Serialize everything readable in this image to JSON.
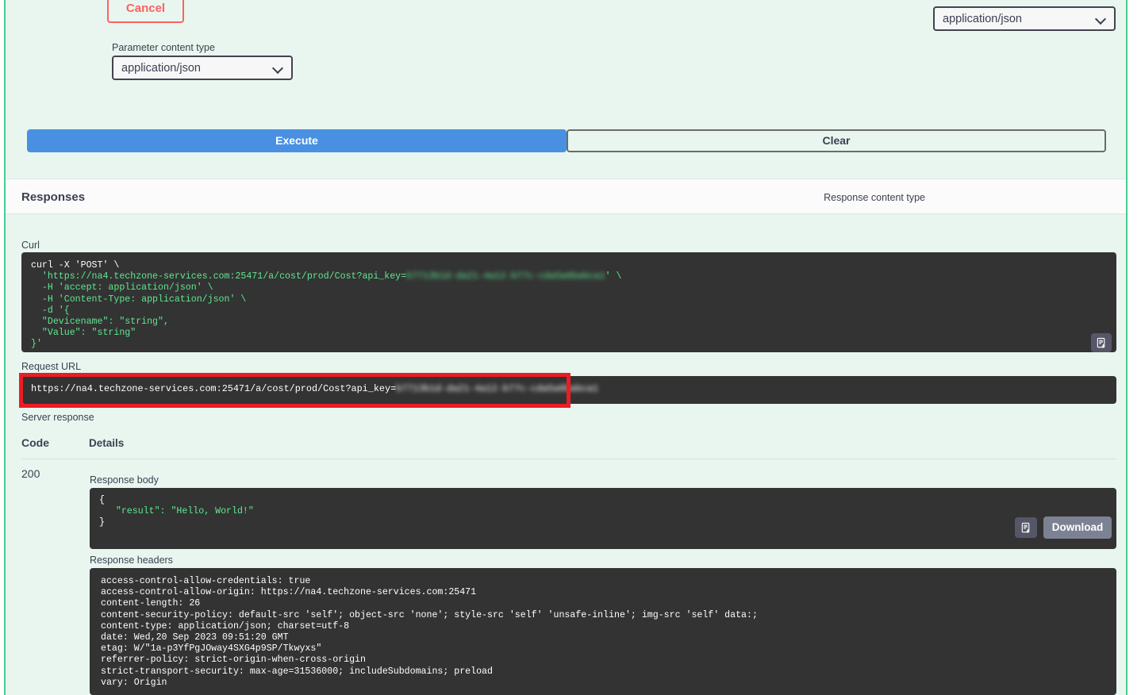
{
  "buttons": {
    "cancel": "Cancel",
    "execute": "Execute",
    "clear": "Clear",
    "download": "Download"
  },
  "parameter_content_type": {
    "label": "Parameter content type",
    "selected": "application/json"
  },
  "responses": {
    "title": "Responses",
    "content_type_label": "Response content type",
    "content_type_selected": "application/json"
  },
  "curl": {
    "label": "Curl",
    "lines": [
      "curl -X 'POST' \\",
      "  'https://na4.techzone-services.com:25471/a/cost/prod/Cost?api_key=",
      "  -H 'accept: application/json' \\",
      "  -H 'Content-Type: application/json' \\",
      "  -d '{",
      "  \"Devicename\": \"string\",",
      "  \"Value\": \"string\"",
      "}'"
    ],
    "api_key_redacted": "b7713b1d-da21-4a12-b77c-cda5a6babca1",
    "copy_icon": "copy-to-clipboard-icon"
  },
  "request_url": {
    "label": "Request URL",
    "value_prefix": "https://na4.techzone-services.com:25471/a/cost/prod/Cost?api_key=",
    "api_key_redacted": "b7713b1d-da21-4a12-b77c-cda5a6babca1",
    "annotation_color": "#ed1c24"
  },
  "server_response": {
    "label": "Server response",
    "columns": [
      "Code",
      "Details"
    ],
    "code": "200",
    "response_body_label": "Response body",
    "response_body": "{\n  \"result\": \"Hello, World!\"\n}",
    "response_body_json": {
      "open": "{",
      "key": "\"result\":",
      "value": "\"Hello, World!\"",
      "close": "}"
    },
    "response_headers_label": "Response headers",
    "response_headers": [
      "access-control-allow-credentials: true",
      "access-control-allow-origin: https://na4.techzone-services.com:25471",
      "content-length: 26",
      "content-security-policy: default-src 'self'; object-src 'none'; style-src 'self' 'unsafe-inline'; img-src 'self' data:;",
      "content-type: application/json; charset=utf-8",
      "date: Wed,20 Sep 2023 09:51:20 GMT",
      "etag: W/\"1a-p3YfPgJOway4SXG4p9SP/Tkwyxs\"",
      "referrer-policy: strict-origin-when-cross-origin",
      "strict-transport-security: max-age=31536000; includeSubdomains; preload",
      "vary: Origin"
    ],
    "copy_icon": "copy-to-clipboard-icon"
  },
  "colors": {
    "accent_blue": "#4990e2",
    "cancel_red": "#ff6060",
    "panel_green": "#49cc90",
    "background_mint": "#e8f6ef",
    "code_bg": "#333333",
    "code_green": "#5ee890"
  }
}
